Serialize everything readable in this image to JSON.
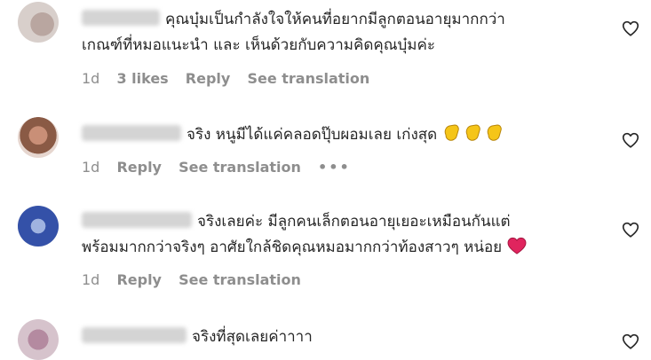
{
  "comments": [
    {
      "text_line1": "คุณบุ๋มเป็นกำลังใจให้คนที่อยากมีลูกตอนอายุมากกว่า",
      "text_line2": "เกณฑ์ที่หมอแนะนำ และ เห็นด้วยกับความคิดคุณบุ๋มค่ะ",
      "age": "1d",
      "likes": "3 likes",
      "reply": "Reply",
      "translate": "See translation"
    },
    {
      "text_line1": "จริง หนูมีได้แค่คลอดปุ๊บผอมเลย เก่งสุด",
      "age": "1d",
      "reply": "Reply",
      "translate": "See translation",
      "more": "•••"
    },
    {
      "text_line1": "จริงเลยค่ะ มีลูกคนเล็กตอนอายุเยอะเหมือนกันแต่",
      "text_line2": "พร้อมมากกว่าจริงๆ อาศัยใกล้ชิดคุณหมอมากกว่าท้องสาวๆ หน่อย",
      "age": "1d",
      "reply": "Reply",
      "translate": "See translation"
    },
    {
      "text_line1": "จริงที่สุดเลยค่าาาา"
    }
  ],
  "icons": {
    "like": "heart-outline-icon",
    "clap": "clapping-hands-emoji",
    "love": "red-heart-emoji"
  },
  "colors": {
    "text": "#262626",
    "meta": "#8e8e8e",
    "heart_emoji": "#e0245e",
    "clap_emoji": "#f5c518"
  }
}
